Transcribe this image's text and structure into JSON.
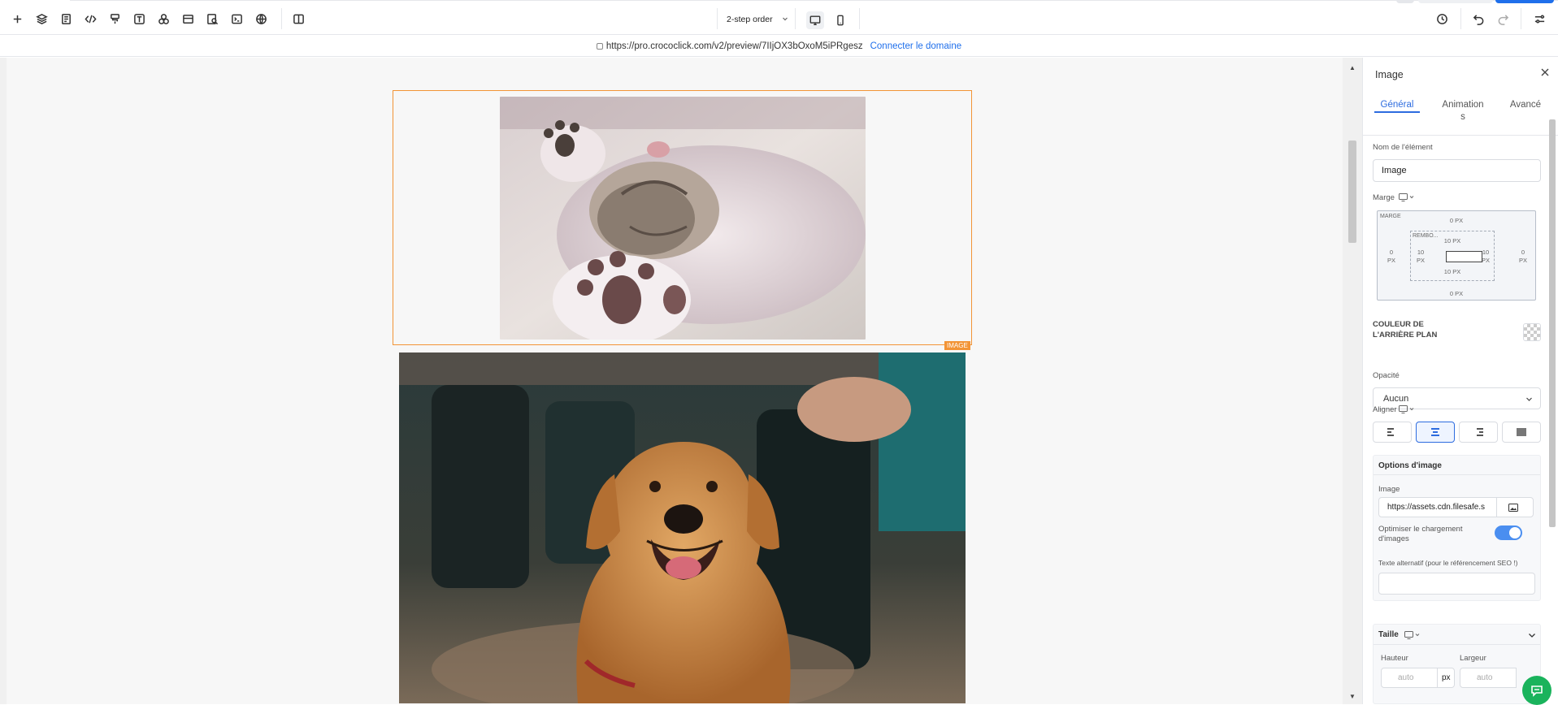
{
  "toolbar": {
    "left_icons": [
      "plus-icon",
      "layers-icon",
      "pages-icon",
      "code-icon",
      "paint-icon",
      "text-icon",
      "shapes-icon",
      "section-icon",
      "search-page-icon",
      "terminal-icon",
      "globe-icon",
      "split-view-icon"
    ],
    "step_select": "2-step order",
    "devices": [
      "desktop-icon",
      "mobile-icon"
    ],
    "right_icons": [
      "history-icon",
      "undo-icon",
      "redo-icon",
      "settings-sliders-icon"
    ]
  },
  "urlbar": {
    "url": "https://pro.crococlick.com/v2/preview/7IIjOX3bOxoM5iPRgesz",
    "connect_label": "Connecter le domaine"
  },
  "canvas": {
    "selected_tag": "IMAGE",
    "images": [
      "kitten-image",
      "golden-retriever-image"
    ]
  },
  "panel": {
    "title": "Image",
    "tabs": [
      {
        "label": "Général"
      },
      {
        "label": "Animation"
      },
      {
        "label": "s"
      },
      {
        "label": "Avancé"
      }
    ],
    "element_name_label": "Nom de l'élément",
    "element_name_value": "Image",
    "margin_label": "Marge",
    "box": {
      "margin_label": "MARGE",
      "padding_label": "REMBO...",
      "margin_top": "0 PX",
      "margin_bottom": "0 PX",
      "margin_left_num": "0",
      "margin_left_unit": "PX",
      "margin_right_num": "0",
      "margin_right_unit": "PX",
      "padding_top": "10 PX",
      "padding_bottom": "10 PX",
      "padding_left_num": "10",
      "padding_left_unit": "PX",
      "padding_right_num": "10",
      "padding_right_unit": "PX"
    },
    "bg_color_label_1": "COULEUR DE",
    "bg_color_label_2": "L'ARRIÈRE PLAN",
    "opacity_label": "Opacité",
    "opacity_value": "Aucun",
    "align_label": "Aligner",
    "image_options": {
      "title": "Options d'image",
      "image_label": "Image",
      "image_url": "https://assets.cdn.filesafe.s",
      "optimize_label_1": "Optimiser le chargement",
      "optimize_label_2": "d'images",
      "alt_label": "Texte alternatif (pour le référencement SEO !)",
      "alt_value": ""
    },
    "size": {
      "title": "Taille",
      "height_label": "Hauteur",
      "width_label": "Largeur",
      "height_placeholder": "auto",
      "width_placeholder": "auto",
      "unit": "px"
    }
  }
}
